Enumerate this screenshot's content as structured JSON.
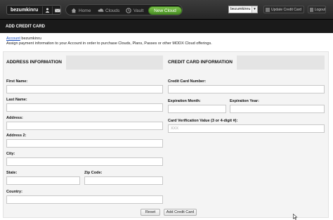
{
  "topbar": {
    "username": "bezumkinru",
    "user_icon": "user-icon",
    "mail_icon": "mail-icon",
    "nav": {
      "home": {
        "label": "Home",
        "icon": "home-icon"
      },
      "clouds": {
        "label": "Clouds",
        "icon": "cloud-icon"
      },
      "vault": {
        "label": "Vault",
        "icon": "vault-icon"
      },
      "new_cloud": {
        "label": "New Cloud"
      }
    },
    "account_select": {
      "value": "bezumkinru"
    },
    "update_card_label": "Update Credit Card",
    "logout_label": "Logout"
  },
  "header": {
    "title": "ADD CREDIT CARD"
  },
  "intro": {
    "link_text": "Account",
    "user_suffix": " bezumkinru",
    "description": "Assign payment information to your Account in order to purchase Clouds, Plans, Passes or other MODX Cloud offerings."
  },
  "address": {
    "heading": "ADDRESS INFORMATION",
    "first_name_label": "First Name:",
    "first_name_value": "",
    "last_name_label": "Last Name:",
    "last_name_value": "",
    "address_label": "Address:",
    "address_value": "",
    "address2_label": "Address 2:",
    "address2_value": "",
    "city_label": "City:",
    "city_value": "",
    "state_label": "State:",
    "state_value": "",
    "zip_label": "Zip Code:",
    "zip_value": "",
    "country_label": "Country:",
    "country_value": ""
  },
  "card": {
    "heading": "CREDIT CARD INFORMATION",
    "number_label": "Credit Card Number:",
    "number_value": "",
    "exp_month_label": "Expiration Month:",
    "exp_month_value": "",
    "exp_year_label": "Expiration Year:",
    "exp_year_value": "",
    "cvv_label": "Card Verification Value (3 or 4-digit #):",
    "cvv_placeholder": "XXX",
    "cvv_value": ""
  },
  "actions": {
    "reset_label": "Reset",
    "add_label": "Add Credit Card"
  },
  "colors": {
    "accent_green": "#5fa832",
    "topbar_bg": "#2f2f2f",
    "header_bg": "#1a1a1a",
    "link_blue": "#1a4fbf"
  }
}
